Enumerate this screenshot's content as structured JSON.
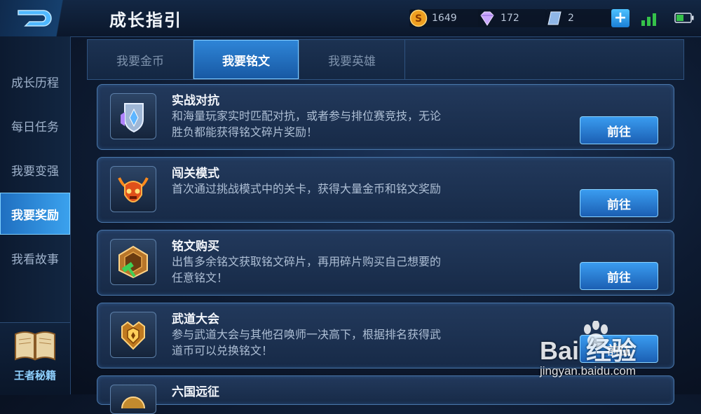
{
  "header": {
    "title": "成长指引",
    "gold": "1649",
    "diamond": "172",
    "ticket": "2",
    "plus": "+"
  },
  "sidebar": {
    "items": [
      {
        "label": "成长历程"
      },
      {
        "label": "每日任务"
      },
      {
        "label": "我要变强"
      },
      {
        "label": "我要奖励"
      },
      {
        "label": "我看故事"
      }
    ],
    "active_index": 3,
    "codex_label": "王者秘籍"
  },
  "tabs": [
    {
      "label": "我要金币"
    },
    {
      "label": "我要铭文"
    },
    {
      "label": "我要英雄"
    }
  ],
  "active_tab": 1,
  "cards": [
    {
      "title": "实战对抗",
      "desc": "和海量玩家实时匹配对抗，或者参与排位赛竞技，无论胜负都能获得铭文碎片奖励！",
      "button": "前往",
      "icon": "shield-crystal-icon"
    },
    {
      "title": "闯关模式",
      "desc": "首次通过挑战模式中的关卡，获得大量金币和铭文奖励",
      "button": "前往",
      "icon": "demon-skull-icon"
    },
    {
      "title": "铭文购买",
      "desc": "出售多余铭文获取铭文碎片，再用碎片购买自己想要的任意铭文！",
      "button": "前往",
      "icon": "hammer-crate-icon"
    },
    {
      "title": "武道大会",
      "desc": "参与武道大会与其他召唤师一决高下，根据排名获得武道币可以兑换铭文！",
      "button": "前往",
      "icon": "trophy-emblem-icon"
    },
    {
      "title": "六国远征",
      "desc": "",
      "button": "",
      "icon": "expedition-icon"
    }
  ],
  "watermark": {
    "logo": "Bai 经验",
    "url": "jingyan.baidu.com"
  },
  "colors": {
    "accent": "#2f86d8",
    "gold": "#f0a020",
    "diamond": "#c9a7ff"
  }
}
